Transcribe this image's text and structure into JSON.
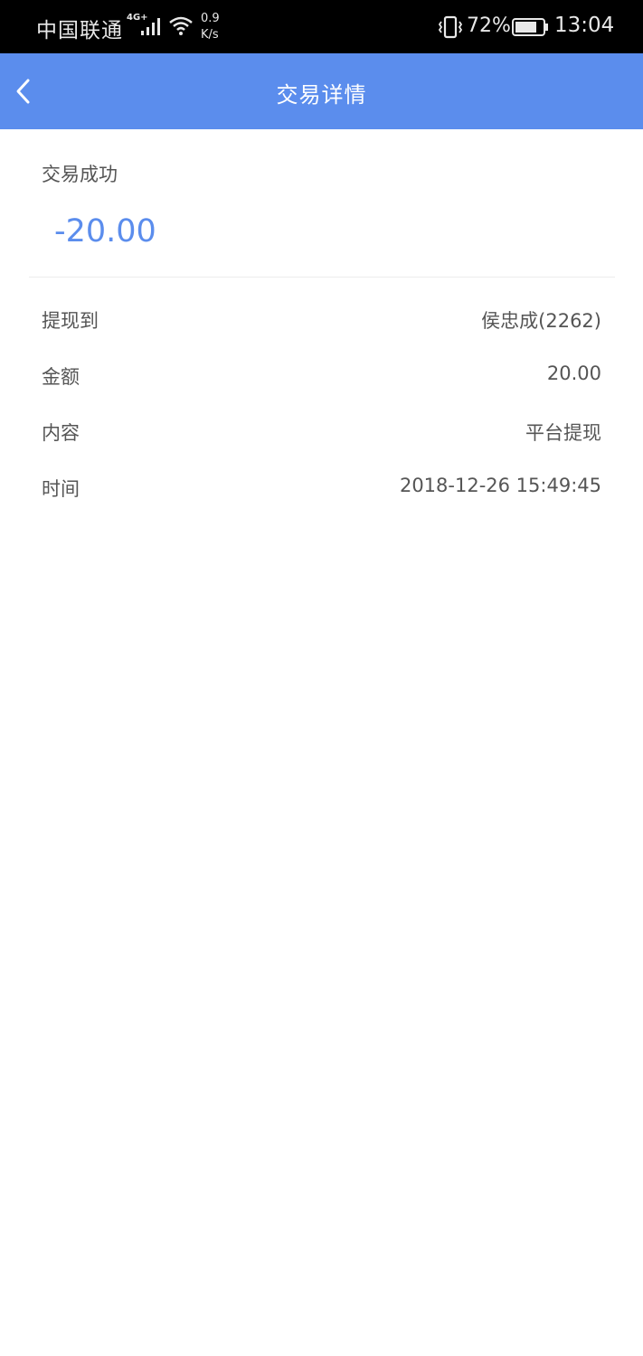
{
  "status_bar": {
    "carrier": "中国联通",
    "network_type": "4G+",
    "net_speed_value": "0.9",
    "net_speed_unit": "K/s",
    "battery_percent": "72%",
    "time": "13:04",
    "icons": [
      "signal-icon",
      "wifi-icon",
      "vibrate-icon",
      "battery-icon"
    ]
  },
  "header": {
    "title": "交易详情",
    "back_icon": "chevron-left-icon",
    "background_color": "#5b8ded"
  },
  "summary": {
    "status": "交易成功",
    "amount": "-20.00",
    "amount_color": "#5b8ded"
  },
  "details": [
    {
      "label": "提现到",
      "value": "侯忠成(2262)"
    },
    {
      "label": "金额",
      "value": "20.00"
    },
    {
      "label": "内容",
      "value": "平台提现"
    },
    {
      "label": "时间",
      "value": "2018-12-26 15:49:45"
    }
  ]
}
